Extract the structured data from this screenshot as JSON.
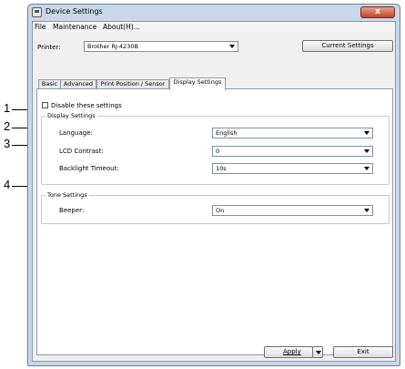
{
  "window": {
    "title": "Device Settings",
    "close_glyph": "x"
  },
  "menu": [
    "File",
    "Maintenance",
    "About(H)..."
  ],
  "printer": {
    "label": "Printer:",
    "value": "Brother RJ-4230B"
  },
  "current_settings_button": "Current Settings",
  "tabs": [
    {
      "label": "Basic",
      "active": false
    },
    {
      "label": "Advanced",
      "active": false
    },
    {
      "label": "Print Position / Sensor",
      "active": false
    },
    {
      "label": "Display Settings",
      "active": true
    }
  ],
  "disable_checkbox": {
    "label": "Disable these settings",
    "checked": false
  },
  "display_group": {
    "title": "Display Settings",
    "rows": [
      {
        "label": "Language:",
        "value": "English"
      },
      {
        "label": "LCD Contrast:",
        "value": "0"
      },
      {
        "label": "Backlight Timeout:",
        "value": "10s"
      }
    ]
  },
  "tone_group": {
    "title": "Tone Settings",
    "rows": [
      {
        "label": "Beeper:",
        "value": "On"
      }
    ]
  },
  "footer": {
    "apply": "Apply",
    "exit": "Exit"
  },
  "callouts": [
    "1",
    "2",
    "3",
    "4"
  ]
}
